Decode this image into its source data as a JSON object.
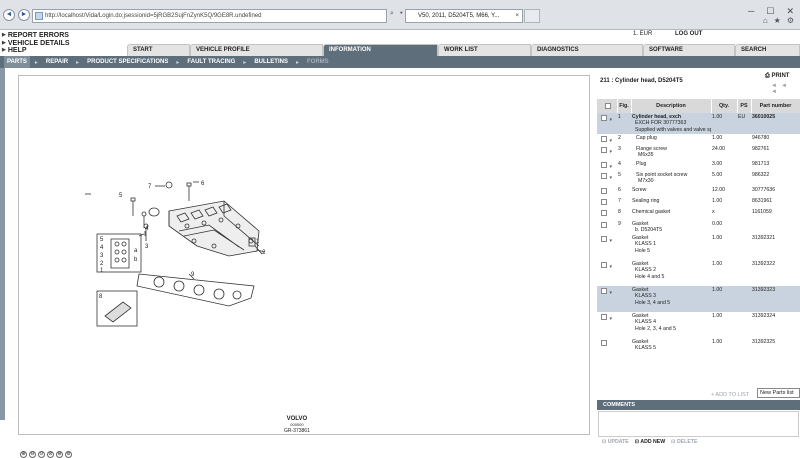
{
  "browser": {
    "address": "http://localhost/Vida/Login.do;jsessionid=5jRGB2SujFnZynK5Q/9GE8R.undefined",
    "tab_title": "V50, 2011, D5204T5, M66, Y...",
    "tab_close": "×",
    "nav_back": "◄",
    "nav_fwd": "►",
    "window_buttons": [
      "─",
      "☐",
      "✕"
    ],
    "toolbar_icons": [
      "⌂",
      "★",
      "⚙"
    ]
  },
  "top_links": [
    "REPORT ERRORS",
    "VEHICLE DETAILS",
    "HELP"
  ],
  "currency": "1. EUR",
  "logout": "LOG OUT",
  "main_tabs": [
    "START",
    "VEHICLE PROFILE",
    "INFORMATION",
    "WORK LIST",
    "DIAGNOSTICS",
    "SOFTWARE",
    "SEARCH"
  ],
  "sub_tabs": [
    "PARTS",
    "REPAIR",
    "PRODUCT SPECIFICATIONS",
    "FAULT TRACING",
    "BULLETINS",
    "FORMS"
  ],
  "diagram": {
    "callouts": [
      "1",
      "2",
      "3",
      "4",
      "5",
      "6",
      "7",
      "8",
      "9",
      "5",
      "4",
      "3",
      "2",
      "1",
      "a",
      "b"
    ],
    "brand": "VOLVO",
    "brand_sub": "000000",
    "ref": "GR-373861",
    "zoom_icons": [
      "⊕",
      "⊖",
      "⊙",
      "⊘",
      "⊛",
      "⊚"
    ]
  },
  "parts": {
    "title": "211 : Cylinder head, D5204T5",
    "print": "PRINT",
    "pager": "◄◄ ◄",
    "headers": [
      "",
      "Fig.",
      "Description",
      "Qty.",
      "PS",
      "Part number"
    ],
    "rows": [
      {
        "fig": "1",
        "desc": [
          "Cylinder head, exch",
          "EXCH FOR 30777363",
          "Supplied with valves and valve springs."
        ],
        "qty": "1.00",
        "ps": "EU",
        "pn": "36010025",
        "sel": true,
        "bold": true
      },
      {
        "fig": "2",
        "desc": [
          "Cap plug"
        ],
        "qty": "1.00",
        "ps": "",
        "pn": "946780",
        "sub": true
      },
      {
        "fig": "3",
        "desc": [
          "Flange screw",
          "M6x35"
        ],
        "qty": "24.00",
        "ps": "",
        "pn": "982761",
        "sub": true
      },
      {
        "fig": "4",
        "desc": [
          "Plug"
        ],
        "qty": "3.00",
        "ps": "",
        "pn": "981713",
        "sub": true
      },
      {
        "fig": "5",
        "desc": [
          "Six point socket screw",
          "M7x30"
        ],
        "qty": "5.00",
        "ps": "",
        "pn": "986322",
        "sub": true
      },
      {
        "fig": "6",
        "desc": [
          "Screw"
        ],
        "qty": "12.00",
        "ps": "",
        "pn": "30777636"
      },
      {
        "fig": "7",
        "desc": [
          "Sealing ring"
        ],
        "qty": "1.00",
        "ps": "",
        "pn": "8631961"
      },
      {
        "fig": "8",
        "desc": [
          "Chemical gasket"
        ],
        "qty": "x",
        "ps": "",
        "pn": "1161059"
      },
      {
        "fig": "9",
        "desc": [
          "Gasket",
          "b. D5204T5"
        ],
        "qty": "0.00",
        "ps": "",
        "pn": ""
      },
      {
        "fig": "",
        "desc": [
          "Gasket",
          "KLASS 1",
          "Hole 5"
        ],
        "qty": "1.00",
        "ps": "",
        "pn": "31392321",
        "tall": true
      },
      {
        "fig": "",
        "desc": [
          "Gasket",
          "KLASS 2",
          "Hole 4 and 5"
        ],
        "qty": "1.00",
        "ps": "",
        "pn": "31392322",
        "tall": true
      },
      {
        "fig": "",
        "desc": [
          "Gasket",
          "KLASS 3",
          "Hole 3, 4 and 5"
        ],
        "qty": "1.00",
        "ps": "",
        "pn": "31392323",
        "tall": true,
        "sel": true
      },
      {
        "fig": "",
        "desc": [
          "Gasket",
          "KLASS 4",
          "Hole 2, 3, 4 and 5"
        ],
        "qty": "1.00",
        "ps": "",
        "pn": "31392324",
        "tall": true
      },
      {
        "fig": "",
        "desc": [
          "Gasket",
          "KLASS 5"
        ],
        "qty": "1.00",
        "ps": "",
        "pn": "31392325"
      }
    ],
    "add_to_list": "+ ADD TO LIST",
    "new_parts": "New Parts list"
  },
  "comments": {
    "title": "COMMENTS",
    "buttons": [
      "UPDATE",
      "ADD NEW",
      "DELETE"
    ]
  }
}
